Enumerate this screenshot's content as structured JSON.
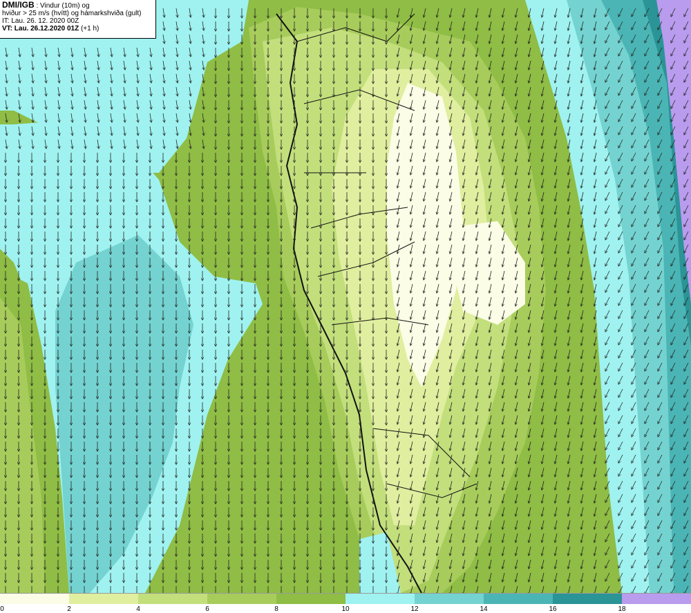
{
  "header": {
    "brand": "DMI/IGB",
    "line1_rest": " : Vindur (10m) og",
    "line2": "hviður > 25 m/s (hvítt) og hámarkshviða (gult)",
    "line3": "IT: Lau. 26. 12. 2020 00Z",
    "line4_bold": "VT: Lau. 26.12.2020 01Z",
    "line4_rest": " (+1 h)"
  },
  "colorbar": {
    "levels": [
      {
        "color": "#fbfde6"
      },
      {
        "color": "#e0ee9f"
      },
      {
        "color": "#c2df7c"
      },
      {
        "color": "#a7cc5b"
      },
      {
        "color": "#8fbd45"
      },
      {
        "color": "#9ff2f0"
      },
      {
        "color": "#74d3d0"
      },
      {
        "color": "#4bb5b5"
      },
      {
        "color": "#2a9496"
      },
      {
        "color": "#b99cee"
      },
      {
        "color": "#9c7ce4"
      }
    ],
    "tick_labels": [
      "0",
      "2",
      "4",
      "6",
      "8",
      "10",
      "12",
      "14",
      "16",
      "18"
    ]
  },
  "map": {
    "wind_direction": "mostly southward arrows, southwest-trending near east coast",
    "coastline_color": "#111111"
  }
}
